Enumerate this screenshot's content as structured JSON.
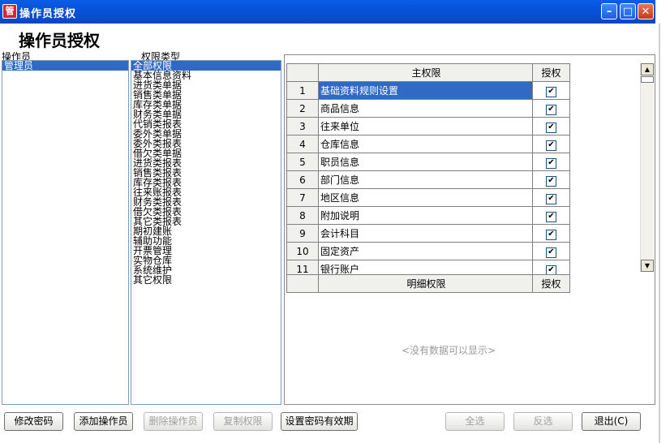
{
  "window": {
    "title": "操作员授权",
    "app_icon_text": "管"
  },
  "page_heading": "操作员授权",
  "operators": {
    "label": "操作员",
    "items": [
      "管理员"
    ]
  },
  "permission_types": {
    "label": "权限类型",
    "items": [
      "全部权限",
      "基本信息资料",
      "进货类单据",
      "销售类单据",
      "库存类单据",
      "财务类单据",
      "代销类报表",
      "委外类单据",
      "委外类报表",
      "借欠类单据",
      "进货类报表",
      "销售类报表",
      "库存类报表",
      "往来账报表",
      "财务类报表",
      "借欠类报表",
      "其它类报表",
      "期初建账",
      "辅助功能",
      "开票管理",
      "实物仓库",
      "系统维护",
      "其它权限"
    ]
  },
  "main_grid": {
    "col_name": "主权限",
    "col_auth": "授权",
    "rows": [
      {
        "n": "1",
        "name": "基础资料规则设置",
        "checked": true
      },
      {
        "n": "2",
        "name": "商品信息",
        "checked": true
      },
      {
        "n": "3",
        "name": "往来单位",
        "checked": true
      },
      {
        "n": "4",
        "name": "仓库信息",
        "checked": true
      },
      {
        "n": "5",
        "name": "职员信息",
        "checked": true
      },
      {
        "n": "6",
        "name": "部门信息",
        "checked": true
      },
      {
        "n": "7",
        "name": "地区信息",
        "checked": true
      },
      {
        "n": "8",
        "name": "附加说明",
        "checked": true
      },
      {
        "n": "9",
        "name": "会计科目",
        "checked": true
      },
      {
        "n": "10",
        "name": "固定资产",
        "checked": true
      },
      {
        "n": "11",
        "name": "银行账户",
        "checked": true
      }
    ]
  },
  "detail_grid": {
    "col_name": "明细权限",
    "col_auth": "授权",
    "empty_text": "<没有数据可以显示>"
  },
  "buttons": {
    "change_password": "修改密码",
    "add_operator": "添加操作员",
    "delete_operator": "删除操作员",
    "copy_permission": "复制权限",
    "set_password_expiry": "设置密码有效期",
    "select_all": "全选",
    "invert_selection": "反选",
    "exit": "退出(C)"
  }
}
